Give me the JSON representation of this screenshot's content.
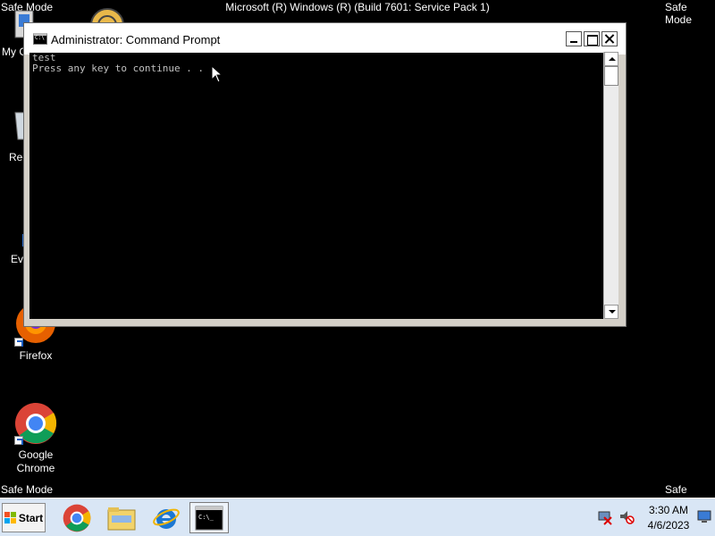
{
  "overlay": {
    "safe_mode": "Safe Mode",
    "build": "Microsoft (R) Windows (R) (Build 7601: Service Pack 1)"
  },
  "desktop": {
    "icons": [
      {
        "label": "My C",
        "icon": "computer-icon"
      },
      {
        "label": "Rec",
        "icon": "recycle-bin-icon"
      },
      {
        "label": "Ev",
        "icon": "everything-icon"
      },
      {
        "label": "Firefox",
        "icon": "firefox-icon"
      },
      {
        "label": "Google Chrome",
        "icon": "chrome-icon"
      }
    ]
  },
  "window": {
    "title": "Administrator:  Command Prompt",
    "console_lines": [
      "test",
      "Press any key to continue . . ."
    ]
  },
  "taskbar": {
    "start_label": "Start",
    "apps": [
      "chrome-icon",
      "explorer-icon",
      "internet-explorer-icon",
      "command-prompt-icon"
    ],
    "clock": {
      "time": "3:30 AM",
      "date": "4/6/2023"
    }
  },
  "colors": {
    "console_bg": "#000000",
    "console_text": "#c0c0c0",
    "taskbar": "#d9e6f5"
  }
}
